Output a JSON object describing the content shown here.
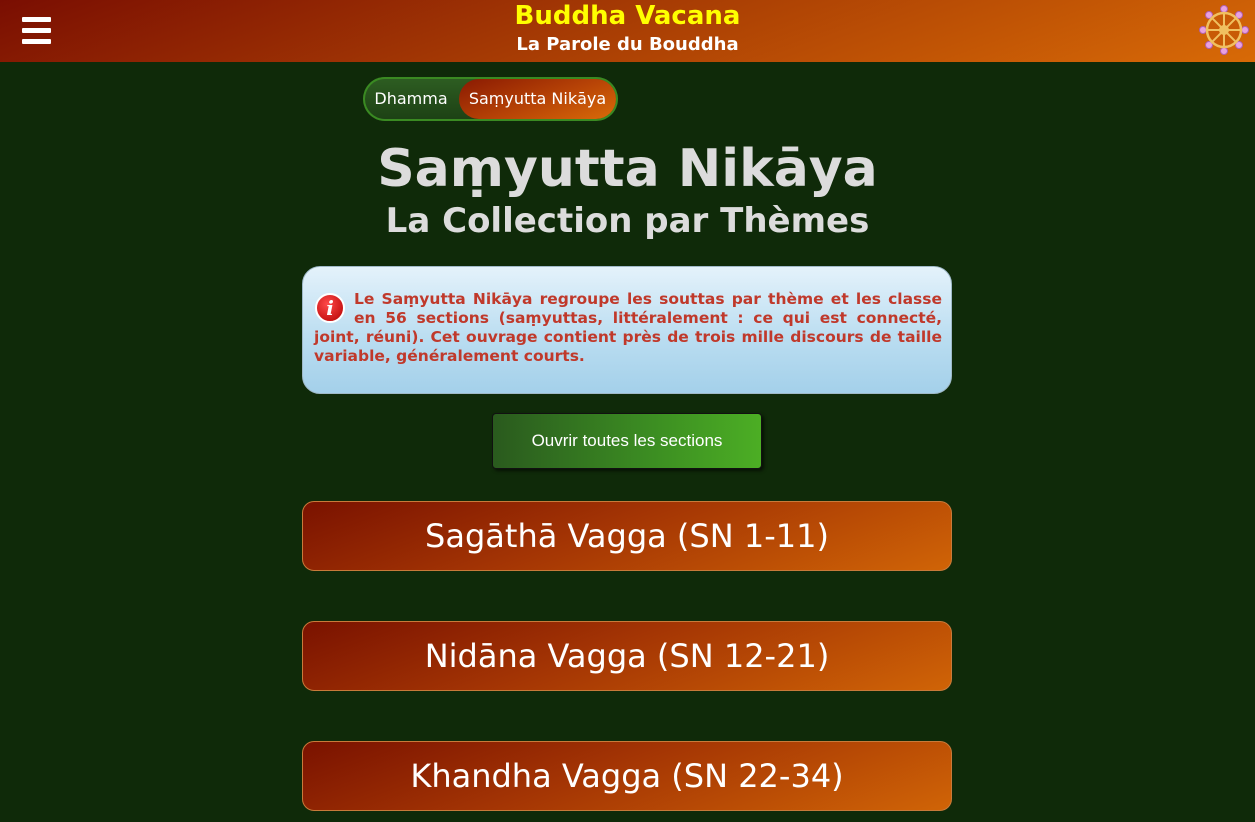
{
  "header": {
    "title": "Buddha Vacana",
    "subtitle": "La Parole du Bouddha",
    "menu_icon": "hamburger-menu-icon",
    "logo_icon": "dharma-wheel-icon"
  },
  "breadcrumb": {
    "items": [
      {
        "label": "Dhamma"
      },
      {
        "label": "Saṃyutta Nikāya"
      }
    ]
  },
  "main": {
    "title": "Saṃyutta Nikāya",
    "subtitle": "La Collection par Thèmes",
    "info": {
      "icon": "info-icon",
      "text": "Le Saṃyutta Nikāya regroupe les souttas par thème et les classe en 56 sections (saṃyuttas, littéralement : ce qui est connecté, joint, réuni). Cet ouvrage contient près de trois mille discours de taille variable, généralement courts."
    },
    "open_all_label": "Ouvrir toutes les sections",
    "sections": [
      {
        "label": "Sagāthā Vagga (SN 1-11)"
      },
      {
        "label": "Nidāna Vagga (SN 12-21)"
      },
      {
        "label": "Khandha Vagga (SN 22-34)"
      }
    ]
  },
  "colors": {
    "background": "#0f2a09",
    "header_gradient_start": "#7a0e02",
    "header_gradient_end": "#d86a06",
    "title_yellow": "#ffff00",
    "info_text_red": "#c0392b",
    "button_green": "#3c8e22"
  }
}
